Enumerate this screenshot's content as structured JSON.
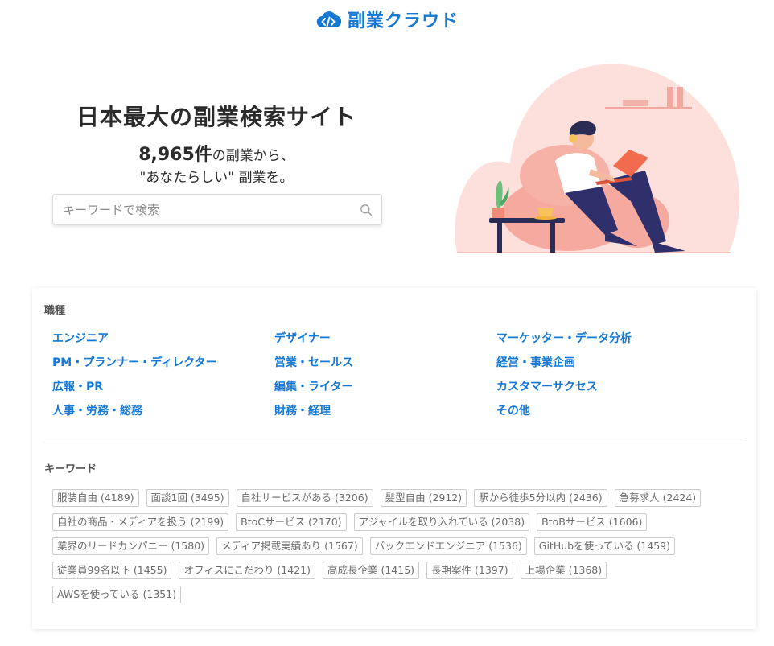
{
  "brand": {
    "name": "副業クラウド",
    "color": "#1478d4"
  },
  "hero": {
    "title": "日本最大の副業検索サイト",
    "count": "8,965件",
    "count_suffix": "の副業から、",
    "tagline": "\"あなたらしい\" 副業を。",
    "search": {
      "placeholder": "キーワードで検索",
      "value": "",
      "icon": "search-icon"
    },
    "illustration": "person-with-laptop-illustration"
  },
  "categories": {
    "heading": "職種",
    "items": [
      "エンジニア",
      "デザイナー",
      "マーケッター・データ分析",
      "PM・プランナー・ディレクター",
      "営業・セールス",
      "経営・事業企画",
      "広報・PR",
      "編集・ライター",
      "カスタマーサクセス",
      "人事・労務・総務",
      "財務・経理",
      "その他"
    ]
  },
  "keywords": {
    "heading": "キーワード",
    "items": [
      "服装自由 (4189)",
      "面談1回 (3495)",
      "自社サービスがある (3206)",
      "髪型自由 (2912)",
      "駅から徒歩5分以内 (2436)",
      "急募求人 (2424)",
      "自社の商品・メディアを扱う (2199)",
      "BtoCサービス (2170)",
      "アジャイルを取り入れている (2038)",
      "BtoBサービス (1606)",
      "業界のリードカンパニー (1580)",
      "メディア掲載実績あり (1567)",
      "バックエンドエンジニア (1536)",
      "GitHubを使っている (1459)",
      "従業員99名以下 (1455)",
      "オフィスにこだわり (1421)",
      "高成長企業 (1415)",
      "長期案件 (1397)",
      "上場企業 (1368)",
      "AWSを使っている (1351)"
    ]
  }
}
